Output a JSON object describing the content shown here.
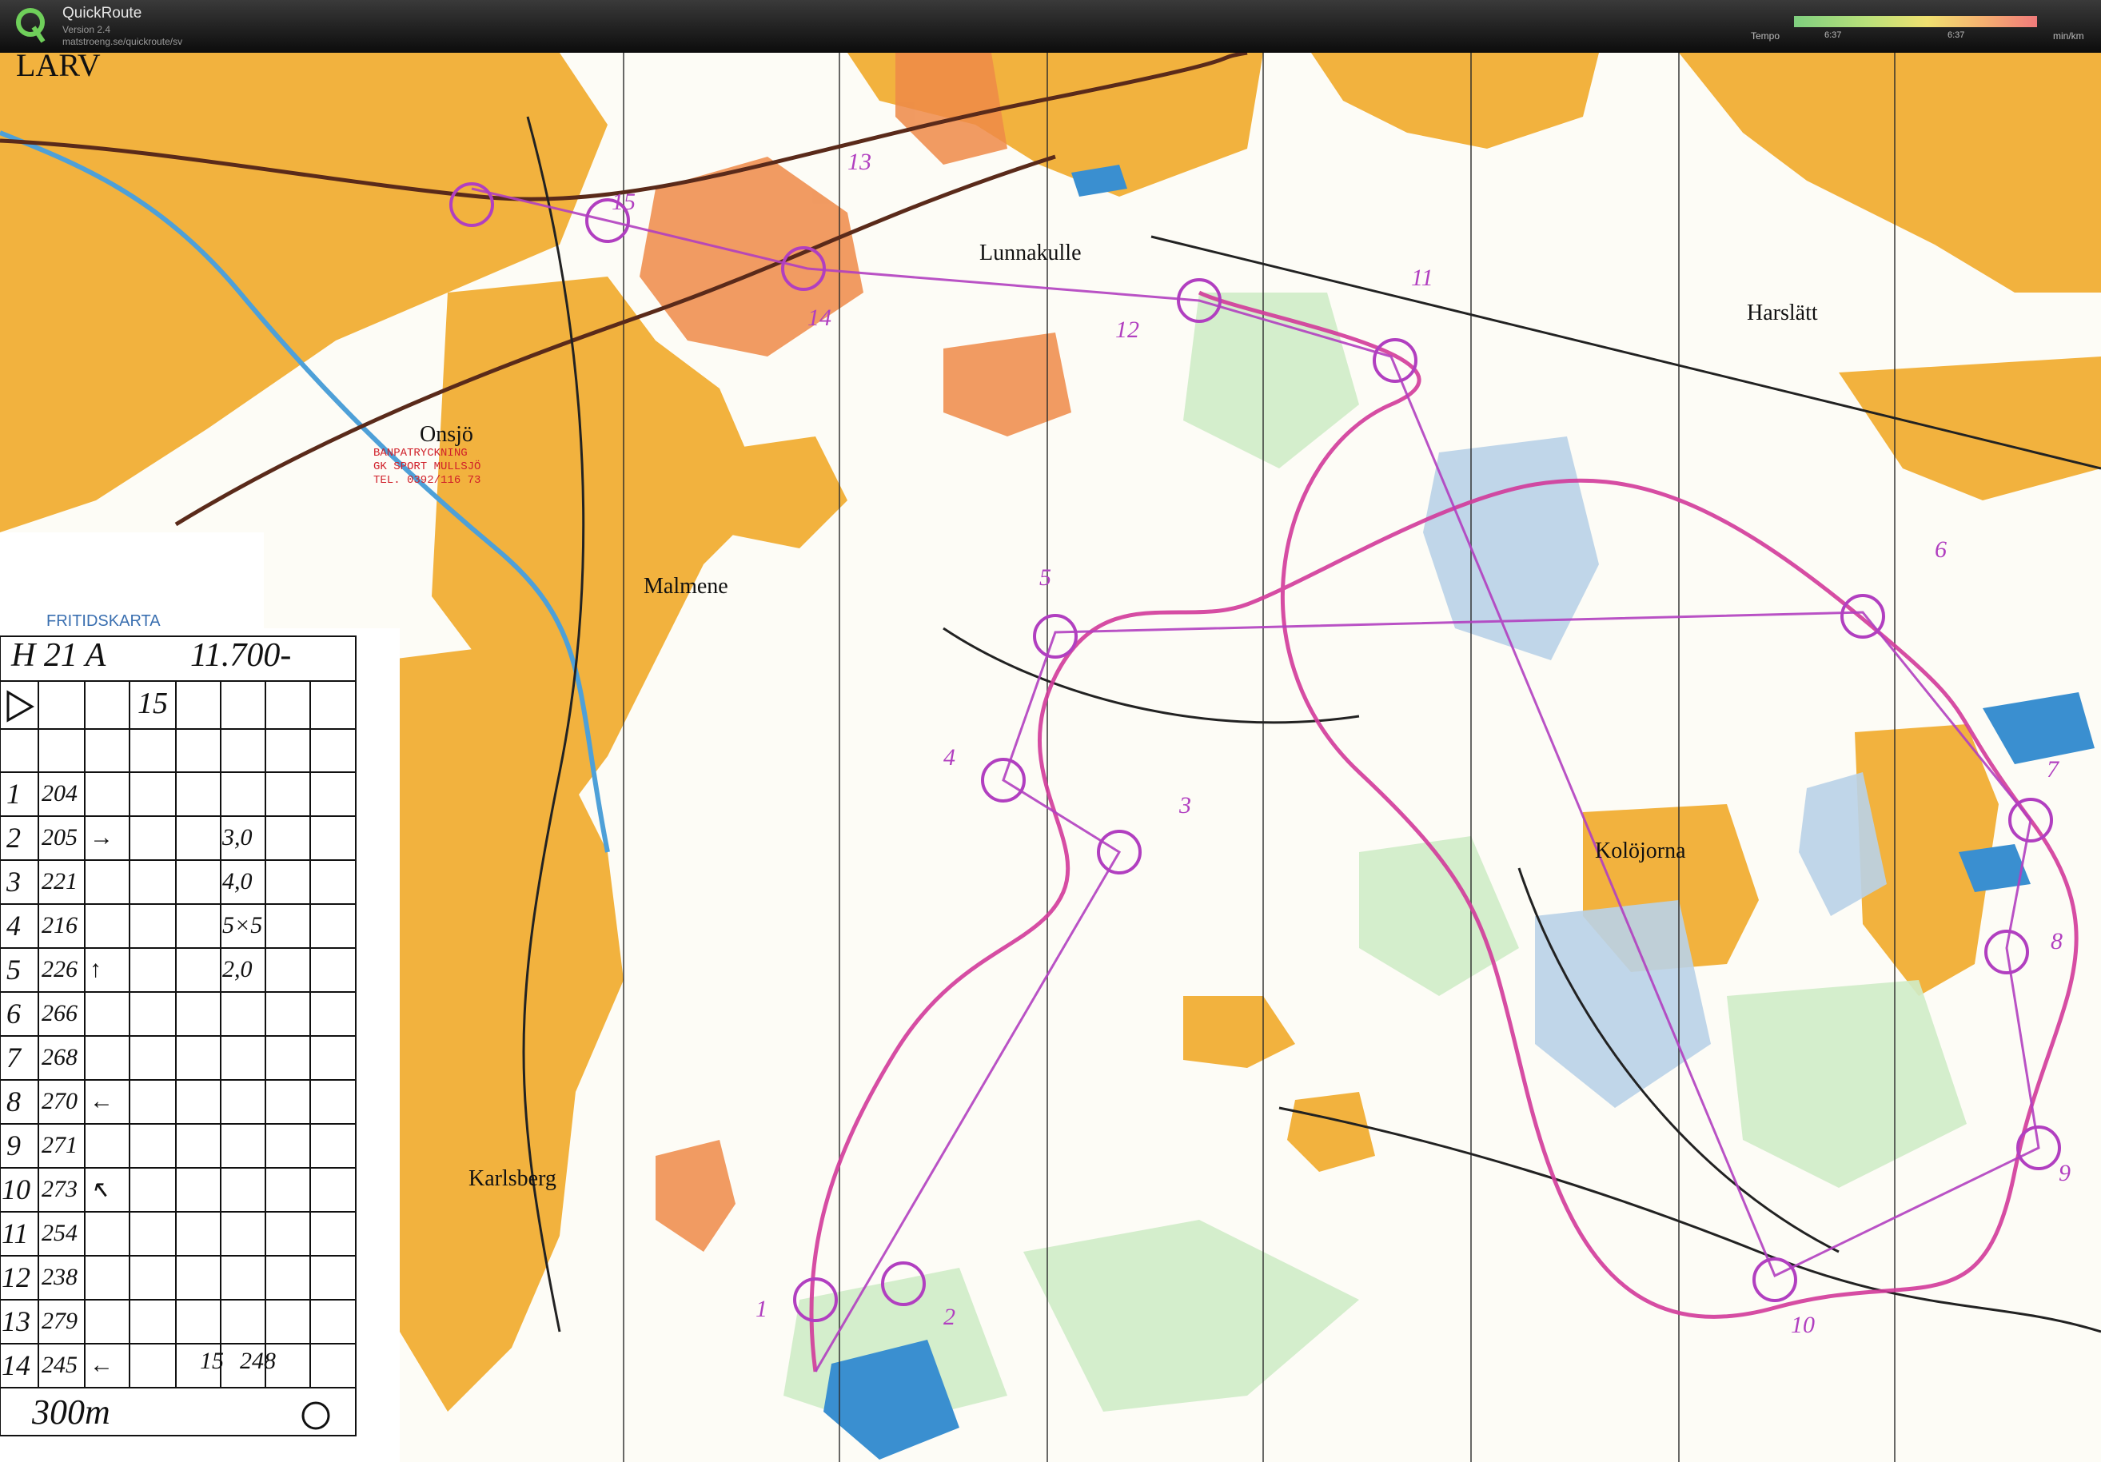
{
  "app": {
    "title": "QuickRoute",
    "version": "Version 2.4",
    "url": "matstroeng.se/quickroute/sv"
  },
  "legend": {
    "label": "Tempo",
    "tick_left": "6:37",
    "tick_right": "6:37",
    "unit": "min/km"
  },
  "map": {
    "place_names": [
      "LARV",
      "Lunnakulle",
      "Harslätt",
      "Onsjö",
      "Malmene",
      "Kolöjorna",
      "Karlsberg"
    ],
    "stamp_lines": [
      "BANPATRYCKNING",
      "GK SPORT MULLSJÖ",
      "TEL. 0392/116 73"
    ],
    "fritidskarta": "FRITIDSKARTA",
    "control_numbers": [
      "1",
      "2",
      "3",
      "4",
      "5",
      "6",
      "7",
      "8",
      "9",
      "10",
      "11",
      "12",
      "13",
      "14",
      "15"
    ]
  },
  "control_card": {
    "class": "H 21 A",
    "length": "11.700-",
    "start_symbol": "15",
    "rows": [
      [
        "1",
        "204",
        "",
        "",
        ""
      ],
      [
        "2",
        "205",
        "→",
        "3,0",
        ""
      ],
      [
        "3",
        "221",
        "",
        "4,0",
        ""
      ],
      [
        "4",
        "216",
        "",
        "5×5",
        ""
      ],
      [
        "5",
        "226",
        "↑",
        "2,0",
        ""
      ],
      [
        "6",
        "266",
        "",
        "",
        ""
      ],
      [
        "7",
        "268",
        "",
        "",
        ""
      ],
      [
        "8",
        "270",
        "←",
        "",
        ""
      ],
      [
        "9",
        "271",
        "",
        "",
        ""
      ],
      [
        "10",
        "273",
        "↖",
        "",
        ""
      ],
      [
        "11",
        "254",
        "",
        "",
        ""
      ],
      [
        "12",
        "238",
        "",
        "",
        ""
      ],
      [
        "13",
        "279",
        "",
        "",
        ""
      ],
      [
        "14",
        "245",
        "←",
        "",
        ""
      ],
      [
        "15",
        "248",
        "",
        "",
        ""
      ]
    ],
    "finish": "300m"
  }
}
